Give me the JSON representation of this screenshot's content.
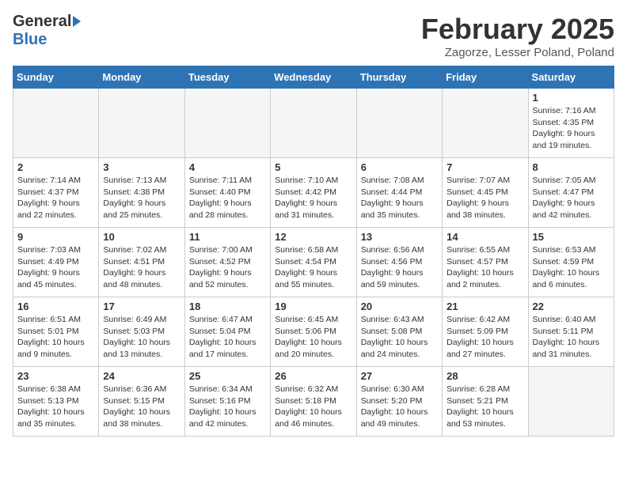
{
  "header": {
    "logo_general": "General",
    "logo_blue": "Blue",
    "title": "February 2025",
    "location": "Zagorze, Lesser Poland, Poland"
  },
  "weekdays": [
    "Sunday",
    "Monday",
    "Tuesday",
    "Wednesday",
    "Thursday",
    "Friday",
    "Saturday"
  ],
  "weeks": [
    [
      {
        "day": "",
        "info": ""
      },
      {
        "day": "",
        "info": ""
      },
      {
        "day": "",
        "info": ""
      },
      {
        "day": "",
        "info": ""
      },
      {
        "day": "",
        "info": ""
      },
      {
        "day": "",
        "info": ""
      },
      {
        "day": "1",
        "info": "Sunrise: 7:16 AM\nSunset: 4:35 PM\nDaylight: 9 hours and 19 minutes."
      }
    ],
    [
      {
        "day": "2",
        "info": "Sunrise: 7:14 AM\nSunset: 4:37 PM\nDaylight: 9 hours and 22 minutes."
      },
      {
        "day": "3",
        "info": "Sunrise: 7:13 AM\nSunset: 4:38 PM\nDaylight: 9 hours and 25 minutes."
      },
      {
        "day": "4",
        "info": "Sunrise: 7:11 AM\nSunset: 4:40 PM\nDaylight: 9 hours and 28 minutes."
      },
      {
        "day": "5",
        "info": "Sunrise: 7:10 AM\nSunset: 4:42 PM\nDaylight: 9 hours and 31 minutes."
      },
      {
        "day": "6",
        "info": "Sunrise: 7:08 AM\nSunset: 4:44 PM\nDaylight: 9 hours and 35 minutes."
      },
      {
        "day": "7",
        "info": "Sunrise: 7:07 AM\nSunset: 4:45 PM\nDaylight: 9 hours and 38 minutes."
      },
      {
        "day": "8",
        "info": "Sunrise: 7:05 AM\nSunset: 4:47 PM\nDaylight: 9 hours and 42 minutes."
      }
    ],
    [
      {
        "day": "9",
        "info": "Sunrise: 7:03 AM\nSunset: 4:49 PM\nDaylight: 9 hours and 45 minutes."
      },
      {
        "day": "10",
        "info": "Sunrise: 7:02 AM\nSunset: 4:51 PM\nDaylight: 9 hours and 48 minutes."
      },
      {
        "day": "11",
        "info": "Sunrise: 7:00 AM\nSunset: 4:52 PM\nDaylight: 9 hours and 52 minutes."
      },
      {
        "day": "12",
        "info": "Sunrise: 6:58 AM\nSunset: 4:54 PM\nDaylight: 9 hours and 55 minutes."
      },
      {
        "day": "13",
        "info": "Sunrise: 6:56 AM\nSunset: 4:56 PM\nDaylight: 9 hours and 59 minutes."
      },
      {
        "day": "14",
        "info": "Sunrise: 6:55 AM\nSunset: 4:57 PM\nDaylight: 10 hours and 2 minutes."
      },
      {
        "day": "15",
        "info": "Sunrise: 6:53 AM\nSunset: 4:59 PM\nDaylight: 10 hours and 6 minutes."
      }
    ],
    [
      {
        "day": "16",
        "info": "Sunrise: 6:51 AM\nSunset: 5:01 PM\nDaylight: 10 hours and 9 minutes."
      },
      {
        "day": "17",
        "info": "Sunrise: 6:49 AM\nSunset: 5:03 PM\nDaylight: 10 hours and 13 minutes."
      },
      {
        "day": "18",
        "info": "Sunrise: 6:47 AM\nSunset: 5:04 PM\nDaylight: 10 hours and 17 minutes."
      },
      {
        "day": "19",
        "info": "Sunrise: 6:45 AM\nSunset: 5:06 PM\nDaylight: 10 hours and 20 minutes."
      },
      {
        "day": "20",
        "info": "Sunrise: 6:43 AM\nSunset: 5:08 PM\nDaylight: 10 hours and 24 minutes."
      },
      {
        "day": "21",
        "info": "Sunrise: 6:42 AM\nSunset: 5:09 PM\nDaylight: 10 hours and 27 minutes."
      },
      {
        "day": "22",
        "info": "Sunrise: 6:40 AM\nSunset: 5:11 PM\nDaylight: 10 hours and 31 minutes."
      }
    ],
    [
      {
        "day": "23",
        "info": "Sunrise: 6:38 AM\nSunset: 5:13 PM\nDaylight: 10 hours and 35 minutes."
      },
      {
        "day": "24",
        "info": "Sunrise: 6:36 AM\nSunset: 5:15 PM\nDaylight: 10 hours and 38 minutes."
      },
      {
        "day": "25",
        "info": "Sunrise: 6:34 AM\nSunset: 5:16 PM\nDaylight: 10 hours and 42 minutes."
      },
      {
        "day": "26",
        "info": "Sunrise: 6:32 AM\nSunset: 5:18 PM\nDaylight: 10 hours and 46 minutes."
      },
      {
        "day": "27",
        "info": "Sunrise: 6:30 AM\nSunset: 5:20 PM\nDaylight: 10 hours and 49 minutes."
      },
      {
        "day": "28",
        "info": "Sunrise: 6:28 AM\nSunset: 5:21 PM\nDaylight: 10 hours and 53 minutes."
      },
      {
        "day": "",
        "info": ""
      }
    ]
  ]
}
